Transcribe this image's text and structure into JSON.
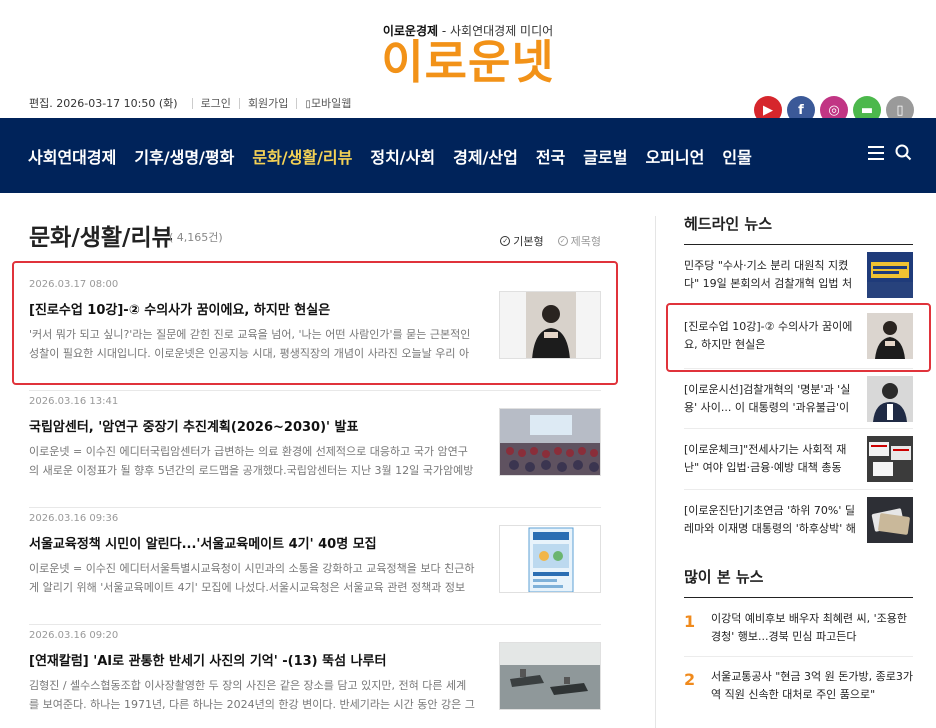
{
  "header": {
    "tagline_brand": "이로운경제",
    "tagline_rest": " - 사회연대경제 미디어",
    "logo": "이로운넷",
    "edit_date": "편집. 2026-03-17 10:50 (화)",
    "login": "로그인",
    "signup": "회원가입",
    "mobile": "모바일웹"
  },
  "social": [
    {
      "icon": "youtube-icon",
      "glyph": "▶",
      "color": "#d6262c"
    },
    {
      "icon": "facebook-icon",
      "glyph": "f",
      "color": "#3b5998"
    },
    {
      "icon": "instagram-icon",
      "glyph": "◎",
      "color": "#c13584"
    },
    {
      "icon": "chat-icon",
      "glyph": "▬",
      "color": "#4cb84c"
    },
    {
      "icon": "mobile-icon",
      "glyph": "▯",
      "color": "#9a9a9a"
    }
  ],
  "nav": {
    "items": [
      "사회연대경제",
      "기후/생명/평화",
      "문화/생활/리뷰",
      "정치/사회",
      "경제/산업",
      "전국",
      "글로벌",
      "오피니언",
      "인물"
    ],
    "active_index": 2
  },
  "section": {
    "title": "문화/생활/리뷰",
    "count": "( 4,165건)",
    "view_basic": "기본형",
    "view_title": "제목형"
  },
  "articles": [
    {
      "date": "2026.03.17 08:00",
      "title": "[진로수업 10강]-② 수의사가 꿈이에요, 하지만 현실은",
      "summary": "'커서 뭐가 되고 싶니?'라는 질문에 갇힌 진로 교육을 넘어, '나는 어떤 사람인가'를 묻는 근본적인 성찰이 필요한 시대입니다. 이로운넷은 인공지능 시대, 평생직장의 개념이 사라진 오늘날 우리 아이들이 주..."
    },
    {
      "date": "2026.03.16 13:41",
      "title": "국립암센터, '암연구 중장기 추진계획(2026~2030)' 발표",
      "summary": "이로운넷 = 이수진 에디터국립암센터가 급변하는 의료 환경에 선제적으로 대응하고 국가 암연구의 새로운 이정표가 될 향후 5년간의 로드맵을 공개했다.국립암센터는 지난 3월 12일 국가암예방검진동 대..."
    },
    {
      "date": "2026.03.16 09:36",
      "title": "서울교육정책 시민이 알린다...'서울교육메이트 4기' 40명 모집",
      "summary": "이로운넷 = 이수진 에디터서울특별시교육청이 시민과의 소통을 강화하고 교육정책을 보다 친근하게 알리기 위해 '서울교육메이트 4기' 모집에 나섰다.서울시교육청은 서울교육 관련 정책과 정보를 시민의 ..."
    },
    {
      "date": "2026.03.16 09:20",
      "title": "[연재칼럼] 'AI로 관통한 반세기 사진의 기억' -(13) 뚝섬 나루터",
      "summary": "김형진 / 셀수스협동조합 이사장촬영한 두 장의 사진은 같은 장소를 담고 있지만, 전혀 다른 세계를 보여준다. 하나는 1971년, 다른 하나는 2024년의 한강 변이다. 반세기라는 시간 동안 강은 그 자리에 그..."
    }
  ],
  "sidebar": {
    "headline_title": "헤드라인 뉴스",
    "headlines": [
      "민주당 \"수사·기소 분리 대원칙 지켰다\" 19일 본회의서 검찰개혁 입법 처리",
      "[진로수업 10강]-② 수의사가 꿈이에요, 하지만 현실은",
      "[이로운시선]검찰개혁의 '명분'과 '실용' 사이... 이 대통령의 '과유불급'이 던진",
      "[이로운체크]\"전세사기는 사회적 재난\" 여야 입법·금융·예방 대책 총동원...",
      "[이로운진단]기초연금 '하위 70%' 딜레마와 이재명 대통령의 '하후상박' 해법"
    ],
    "popular_title": "많이 본 뉴스",
    "popular": [
      {
        "rank": "1",
        "text": "이강덕 예비후보 배우자 최혜련 씨, '조용한 경청' 행보...경북 민심 파고든다"
      },
      {
        "rank": "2",
        "text": "서울교통공사 \"현금 3억 원 돈가방, 종로3가역 직원 신속한 대처로 주인 품으로\""
      }
    ]
  }
}
